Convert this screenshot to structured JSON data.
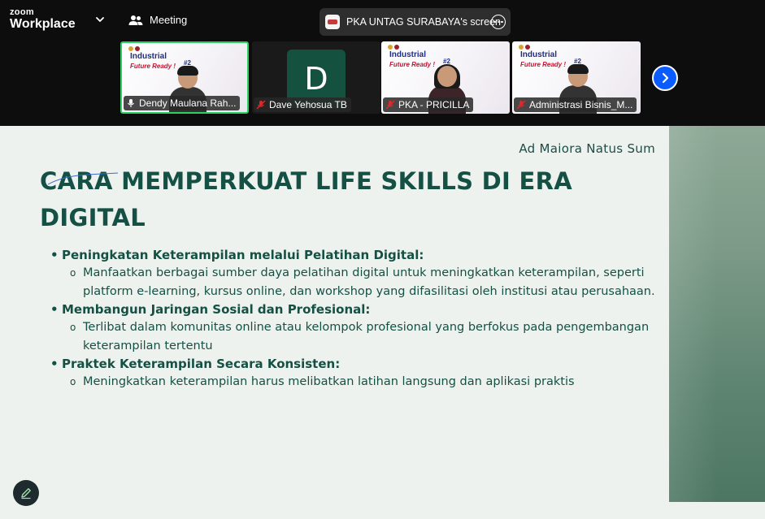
{
  "app": {
    "brand_small": "zoom",
    "brand_big": "Workplace",
    "meeting_label": "Meeting",
    "share_label": "PKA UNTAG SURABAYA's screen"
  },
  "participants": [
    {
      "name": "Dendy Maulana Rah...",
      "type": "video",
      "active": true
    },
    {
      "name": "Dave Yehosua TB",
      "type": "avatar",
      "initial": "D"
    },
    {
      "name": "PKA - PRICILLA",
      "type": "video"
    },
    {
      "name": "Administrasi Bisnis_M...",
      "type": "video"
    }
  ],
  "tile_slide": {
    "title": "Industrial",
    "subtitle": "Future Ready !",
    "number": "#2"
  },
  "slide": {
    "motto": "Ad Maiora Natus Sum",
    "title": "CARA MEMPERKUAT LIFE SKILLS DI ERA DIGITAL",
    "sections": [
      {
        "heading": "Peningkatan Keterampilan melalui Pelatihan Digital:",
        "items": [
          "Manfaatkan berbagai sumber daya pelatihan digital untuk meningkatkan keterampilan, seperti platform e-learning, kursus online, dan workshop yang difasilitasi oleh institusi atau perusahaan."
        ]
      },
      {
        "heading": "Membangun Jaringan Sosial dan Profesional:",
        "items": [
          "Terlibat dalam komunitas online atau kelompok profesional yang berfokus pada pengembangan keterampilan tertentu"
        ]
      },
      {
        "heading": "Praktek Keterampilan Secara Konsisten:",
        "items": [
          "Meningkatkan keterampilan harus melibatkan latihan langsung dan aplikasi praktis"
        ]
      }
    ]
  },
  "colors": {
    "accent_green": "#2bd163",
    "next_blue": "#0b5cff",
    "slide_text": "#155044",
    "mute_red": "#e02828"
  }
}
